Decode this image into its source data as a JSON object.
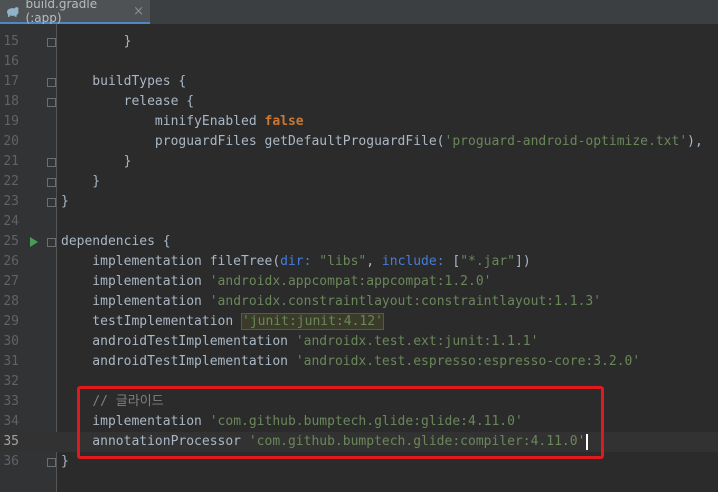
{
  "tab": {
    "title": "build.gradle (:app)",
    "icon": "gradle-icon",
    "close": "×"
  },
  "lines": [
    {
      "n": "15",
      "parts": [
        {
          "t": "        "
        },
        {
          "t": "}"
        }
      ]
    },
    {
      "n": "16",
      "parts": []
    },
    {
      "n": "17",
      "parts": [
        {
          "t": "    buildTypes {"
        }
      ]
    },
    {
      "n": "18",
      "parts": [
        {
          "t": "        release {"
        }
      ]
    },
    {
      "n": "19",
      "parts": [
        {
          "t": "            minifyEnabled "
        },
        {
          "t": "false",
          "c": "kw"
        }
      ]
    },
    {
      "n": "20",
      "parts": [
        {
          "t": "            proguardFiles getDefaultProguardFile("
        },
        {
          "t": "'proguard-android-optimize.txt'",
          "c": "str"
        },
        {
          "t": "),"
        }
      ]
    },
    {
      "n": "21",
      "parts": [
        {
          "t": "        }"
        }
      ]
    },
    {
      "n": "22",
      "parts": [
        {
          "t": "    }"
        }
      ]
    },
    {
      "n": "23",
      "parts": [
        {
          "t": "}"
        }
      ]
    },
    {
      "n": "24",
      "parts": []
    },
    {
      "n": "25",
      "parts": [
        {
          "t": "dependencies {"
        }
      ]
    },
    {
      "n": "26",
      "parts": [
        {
          "t": "    implementation fileTree("
        },
        {
          "t": "dir:",
          "c": "named"
        },
        {
          "t": " "
        },
        {
          "t": "\"libs\"",
          "c": "str"
        },
        {
          "t": ", "
        },
        {
          "t": "include:",
          "c": "named"
        },
        {
          "t": " ["
        },
        {
          "t": "\"*.jar\"",
          "c": "str"
        },
        {
          "t": "])"
        }
      ]
    },
    {
      "n": "27",
      "parts": [
        {
          "t": "    implementation "
        },
        {
          "t": "'androidx.appcompat:appcompat:1.2.0'",
          "c": "str"
        }
      ]
    },
    {
      "n": "28",
      "parts": [
        {
          "t": "    implementation "
        },
        {
          "t": "'androidx.constraintlayout:constraintlayout:1.1.3'",
          "c": "str"
        }
      ]
    },
    {
      "n": "29",
      "parts": [
        {
          "t": "    testImplementation "
        },
        {
          "t": "'junit:junit:4.12'",
          "c": "str hl"
        }
      ]
    },
    {
      "n": "30",
      "parts": [
        {
          "t": "    androidTestImplementation "
        },
        {
          "t": "'androidx.test.ext:junit:1.1.1'",
          "c": "str"
        }
      ]
    },
    {
      "n": "31",
      "parts": [
        {
          "t": "    androidTestImplementation "
        },
        {
          "t": "'androidx.test.espresso:espresso-core:3.2.0'",
          "c": "str"
        }
      ]
    },
    {
      "n": "32",
      "parts": []
    },
    {
      "n": "33",
      "parts": [
        {
          "t": "    "
        },
        {
          "t": "// 글라이드",
          "c": "cmt"
        }
      ]
    },
    {
      "n": "34",
      "parts": [
        {
          "t": "    implementation "
        },
        {
          "t": "'com.github.bumptech.glide:glide:4.11.0'",
          "c": "str"
        }
      ]
    },
    {
      "n": "35",
      "parts": [
        {
          "t": "    annotationProcessor "
        },
        {
          "t": "'com.github.bumptech.glide:compiler:4.11.0'",
          "c": "str"
        }
      ],
      "current": true
    },
    {
      "n": "36",
      "parts": [
        {
          "t": "}"
        }
      ]
    }
  ],
  "colors": {
    "background": "#2b2b2b",
    "keyword": "#cc7832",
    "string": "#6a8759",
    "comment": "#808080",
    "named_arg": "#467cda",
    "highlight_box": "#e0191e"
  }
}
